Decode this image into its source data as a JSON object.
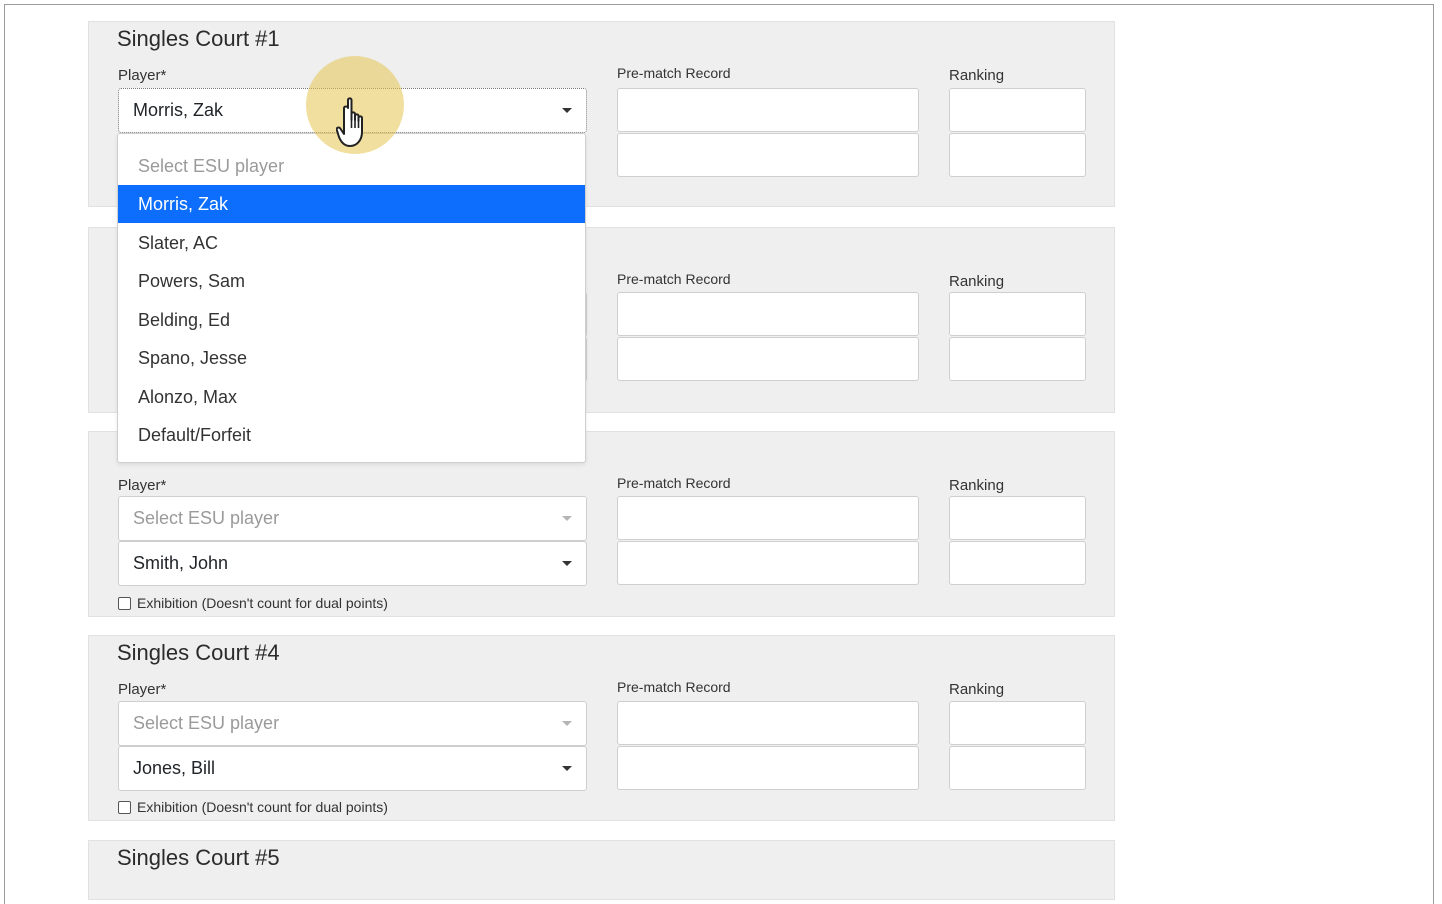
{
  "labels": {
    "player": "Player*",
    "record": "Pre-match Record",
    "ranking": "Ranking",
    "exhibition": "Exhibition (Doesn't count for dual points)",
    "placeholder": "Select ESU player"
  },
  "courts": [
    {
      "title": "Singles Court #1",
      "player1": "Morris, Zak",
      "player2": ""
    },
    {
      "title": "",
      "player1": "",
      "player2": ""
    },
    {
      "title": "",
      "player1": "",
      "player2": "Smith, John"
    },
    {
      "title": "Singles Court #4",
      "player1": "",
      "player2": "Jones, Bill"
    },
    {
      "title": "Singles Court #5"
    }
  ],
  "dropdown": {
    "placeholder": "Select ESU player",
    "selected": "Morris, Zak",
    "options": [
      "Morris, Zak",
      "Slater, AC",
      "Powers, Sam",
      "Belding, Ed",
      "Spano, Jesse",
      "Alonzo, Max",
      "Default/Forfeit"
    ]
  },
  "colors": {
    "accent": "#0d6efd",
    "panel": "#efefef",
    "highlight": "#e6c450"
  },
  "icons": {
    "cursor": "hand-pointer-icon",
    "caret": "caret-down-icon",
    "checkbox": "checkbox-icon"
  }
}
